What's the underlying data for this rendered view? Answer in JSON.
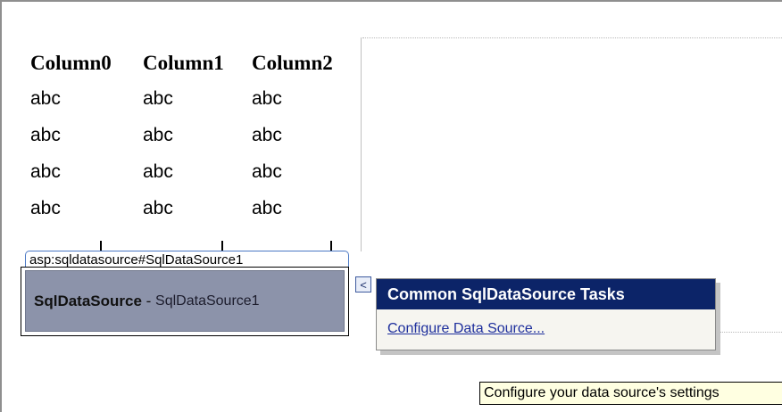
{
  "gridview": {
    "headers": [
      "Column0",
      "Column1",
      "Column2"
    ],
    "rows": [
      [
        "abc",
        "abc",
        "abc"
      ],
      [
        "abc",
        "abc",
        "abc"
      ],
      [
        "abc",
        "abc",
        "abc"
      ],
      [
        "abc",
        "abc",
        "abc"
      ]
    ]
  },
  "datasource": {
    "tag": "asp:sqldatasource#SqlDataSource1",
    "type_label": "SqlDataSource",
    "separator": " - ",
    "id_label": "SqlDataSource1"
  },
  "smart_tag": {
    "glyph": "<"
  },
  "tasks_panel": {
    "title": "Common SqlDataSource Tasks",
    "link": "Configure Data Source..."
  },
  "tooltip": {
    "text": "Configure your data source's settings"
  }
}
